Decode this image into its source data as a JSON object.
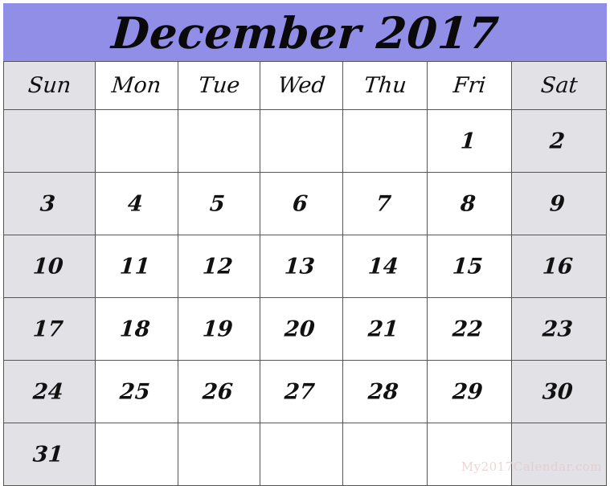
{
  "calendar": {
    "title": "December 2017",
    "month": "December",
    "year": "2017",
    "theme": {
      "banner_color": "#908ee6",
      "weekend_shade": "#e2e1e6",
      "grid_line_color": "#555555",
      "text_color": "#111111",
      "page_background": "#ffffff",
      "watermark_color": "#e6c8c8"
    },
    "weekdays": [
      {
        "short": "Sun",
        "weekend": true
      },
      {
        "short": "Mon",
        "weekend": false
      },
      {
        "short": "Tue",
        "weekend": false
      },
      {
        "short": "Wed",
        "weekend": false
      },
      {
        "short": "Thu",
        "weekend": false
      },
      {
        "short": "Fri",
        "weekend": false
      },
      {
        "short": "Sat",
        "weekend": true
      }
    ],
    "weeks": [
      [
        "",
        "",
        "",
        "",
        "",
        "1",
        "2"
      ],
      [
        "3",
        "4",
        "5",
        "6",
        "7",
        "8",
        "9"
      ],
      [
        "10",
        "11",
        "12",
        "13",
        "14",
        "15",
        "16"
      ],
      [
        "17",
        "18",
        "19",
        "20",
        "21",
        "22",
        "23"
      ],
      [
        "24",
        "25",
        "26",
        "27",
        "28",
        "29",
        "30"
      ],
      [
        "31",
        "",
        "",
        "",
        "",
        "",
        ""
      ]
    ],
    "watermark": "My2017Calendar.com"
  }
}
